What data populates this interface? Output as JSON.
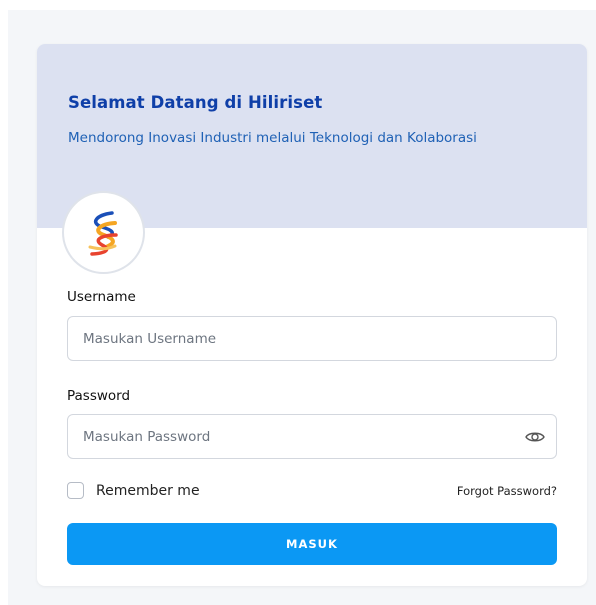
{
  "header": {
    "title": "Selamat Datang di Hiliriset",
    "subtitle": "Mendorong Inovasi Industri melalui Teknologi dan Kolaborasi"
  },
  "logo": {
    "icon": "hiliriset-logo-icon",
    "colors": [
      "#1a4fb8",
      "#f5a623",
      "#e8432e"
    ]
  },
  "form": {
    "username": {
      "label": "Username",
      "placeholder": "Masukan Username",
      "value": ""
    },
    "password": {
      "label": "Password",
      "placeholder": "Masukan Password",
      "value": "",
      "toggle_icon": "eye-icon"
    },
    "remember_label": "Remember me",
    "remember_checked": false,
    "forgot_label": "Forgot Password?",
    "submit_label": "MASUK"
  },
  "colors": {
    "header_bg": "#dce1f1",
    "title": "#0f3fa8",
    "subtitle": "#1f61b5",
    "button": "#0b98f4"
  }
}
